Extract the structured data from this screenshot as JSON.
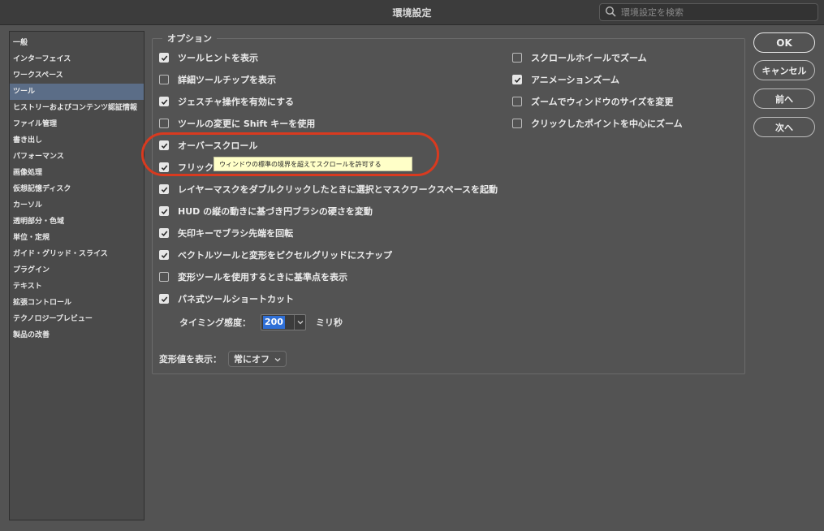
{
  "window": {
    "title": "環境設定"
  },
  "search": {
    "placeholder": "環境設定を検索"
  },
  "sidebar": {
    "items": [
      "一般",
      "インターフェイス",
      "ワークスペース",
      "ツール",
      "ヒストリーおよびコンテンツ認証情報",
      "ファイル管理",
      "書き出し",
      "パフォーマンス",
      "画像処理",
      "仮想記憶ディスク",
      "カーソル",
      "透明部分・色域",
      "単位・定規",
      "ガイド・グリッド・スライス",
      "プラグイン",
      "テキスト",
      "拡張コントロール",
      "テクノロジープレビュー",
      "製品の改善"
    ],
    "selected_index": 3
  },
  "options": {
    "legend": "オプション",
    "left": [
      {
        "label": "ツールヒントを表示",
        "checked": true
      },
      {
        "label": "詳細ツールチップを表示",
        "checked": false
      },
      {
        "label": "ジェスチャ操作を有効にする",
        "checked": true
      },
      {
        "label": "ツールの変更に Shift キーを使用",
        "checked": false
      },
      {
        "label": "オーバースクロール",
        "checked": true
      },
      {
        "label": "フリック",
        "checked": true
      },
      {
        "label": "レイヤーマスクをダブルクリックしたときに選択とマスクワークスペースを起動",
        "checked": true
      },
      {
        "label": "HUD の縦の動きに基づき円ブラシの硬さを変動",
        "checked": true
      },
      {
        "label": "矢印キーでブラシ先端を回転",
        "checked": true
      },
      {
        "label": "ベクトルツールと変形をピクセルグリッドにスナップ",
        "checked": true
      },
      {
        "label": "変形ツールを使用するときに基準点を表示",
        "checked": false
      },
      {
        "label": "パネ式ツールショートカット",
        "checked": true
      }
    ],
    "right": [
      {
        "label": "スクロールホイールでズーム",
        "checked": false
      },
      {
        "label": "アニメーションズーム",
        "checked": true
      },
      {
        "label": "ズームでウィンドウのサイズを変更",
        "checked": false
      },
      {
        "label": "クリックしたポイントを中心にズーム",
        "checked": false
      }
    ],
    "timing": {
      "label": "タイミング感度：",
      "value": "200",
      "unit": "ミリ秒"
    },
    "transform": {
      "label": "変形値を表示：",
      "value": "常にオフ"
    }
  },
  "tooltip": {
    "text": "ウィンドウの標準の境界を超えてスクロールを許可する"
  },
  "buttons": {
    "ok": "OK",
    "cancel": "キャンセル",
    "prev": "前へ",
    "next": "次へ"
  },
  "colors": {
    "highlight": "#d93a1f",
    "selection": "#5b6d87",
    "tooltip_bg": "#ffffc8"
  }
}
